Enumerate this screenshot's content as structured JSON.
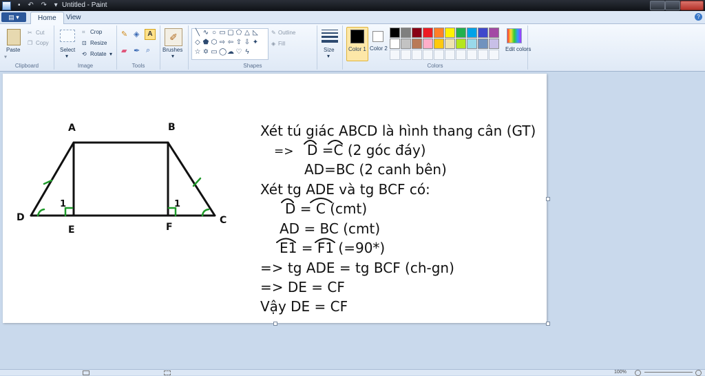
{
  "window": {
    "title": "Untitled - Paint"
  },
  "tabs": [
    {
      "label": "Home",
      "active": true
    },
    {
      "label": "View",
      "active": false
    }
  ],
  "ribbon": {
    "clipboard": {
      "paste": "Paste",
      "cut": "Cut",
      "copy": "Copy",
      "label": "Clipboard"
    },
    "image": {
      "select": "Select",
      "crop": "Crop",
      "resize": "Resize",
      "rotate": "Rotate",
      "label": "Image"
    },
    "tools": {
      "label": "Tools"
    },
    "brushes": {
      "label": "Brushes"
    },
    "shapes": {
      "outline": "Outline",
      "fill": "Fill",
      "label": "Shapes"
    },
    "size": {
      "label": "Size"
    },
    "colors": {
      "color1": "Color 1",
      "color2": "Color 2",
      "edit": "Edit colors",
      "label": "Colors",
      "color1_value": "#000000",
      "color2_value": "#ffffff",
      "palette_row1": [
        "#000000",
        "#7f7f7f",
        "#880015",
        "#ed1c24",
        "#ff7f27",
        "#fff200",
        "#22b14c",
        "#00a2e8",
        "#3f48cc",
        "#a349a4"
      ],
      "palette_row2": [
        "#ffffff",
        "#c3c3c3",
        "#b97a57",
        "#ffaec9",
        "#ffc90e",
        "#efe4b0",
        "#b5e61d",
        "#99d9ea",
        "#7092be",
        "#c8bfe7"
      ]
    }
  },
  "drawing": {
    "figure_labels": {
      "A": "A",
      "B": "B",
      "C": "C",
      "D": "D",
      "E": "E",
      "F": "F",
      "one_left": "1",
      "one_right": "1"
    },
    "lines": [
      "Xét tú giác ABCD là hình thang cân (GT)",
      "=>",
      "D =C (2 góc đáy)",
      "AD=BC (2 canh bên)",
      "Xét tg ADE và tg BCF có:",
      "D = C (cmt)",
      "AD = BC (cmt)",
      "E1 = F1 (=90*)",
      "=> tg ADE = tg BCF (ch-gn)",
      "=> DE = CF",
      "Vậy DE = CF"
    ],
    "colors": {
      "ink": "#111111",
      "mark": "#1f9a2a"
    }
  },
  "statusbar": {
    "zoom": "100%"
  }
}
